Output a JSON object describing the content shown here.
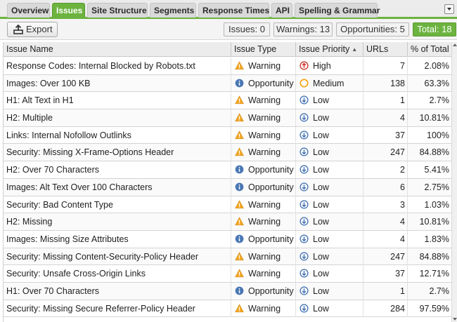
{
  "tabs": [
    {
      "label": "Overview",
      "active": false
    },
    {
      "label": "Issues",
      "active": true
    },
    {
      "label": "Site Structure",
      "active": false
    },
    {
      "label": "Segments",
      "active": false
    },
    {
      "label": "Response Times",
      "active": false
    },
    {
      "label": "API",
      "active": false
    },
    {
      "label": "Spelling & Grammar",
      "active": false
    }
  ],
  "toolbar": {
    "export_label": "Export",
    "issues": "Issues: 0",
    "warnings": "Warnings: 13",
    "opportunities": "Opportunities: 5",
    "total": "Total: 18"
  },
  "columns": {
    "name": "Issue Name",
    "type": "Issue Type",
    "priority": "Issue Priority",
    "urls": "URLs",
    "pct": "% of Total"
  },
  "colors": {
    "accent": "#6cb33f",
    "warning": "#f5a623",
    "opportunity": "#4a77b4",
    "high": "#d0342c",
    "medium": "#f2a20c",
    "low": "#4a77b4"
  },
  "rows": [
    {
      "name": "Response Codes: Internal Blocked by Robots.txt",
      "type": "Warning",
      "type_icon": "warning-icon",
      "priority": "High",
      "priority_icon": "arrow-up-circle-icon",
      "urls": "7",
      "pct": "2.08%"
    },
    {
      "name": "Images: Over 100 KB",
      "type": "Opportunity",
      "type_icon": "info-icon",
      "priority": "Medium",
      "priority_icon": "circle-icon",
      "urls": "138",
      "pct": "63.3%"
    },
    {
      "name": "H1: Alt Text in H1",
      "type": "Warning",
      "type_icon": "warning-icon",
      "priority": "Low",
      "priority_icon": "arrow-down-circle-icon",
      "urls": "1",
      "pct": "2.7%"
    },
    {
      "name": "H2: Multiple",
      "type": "Warning",
      "type_icon": "warning-icon",
      "priority": "Low",
      "priority_icon": "arrow-down-circle-icon",
      "urls": "4",
      "pct": "10.81%"
    },
    {
      "name": "Links: Internal Nofollow Outlinks",
      "type": "Warning",
      "type_icon": "warning-icon",
      "priority": "Low",
      "priority_icon": "arrow-down-circle-icon",
      "urls": "37",
      "pct": "100%"
    },
    {
      "name": "Security: Missing X-Frame-Options Header",
      "type": "Warning",
      "type_icon": "warning-icon",
      "priority": "Low",
      "priority_icon": "arrow-down-circle-icon",
      "urls": "247",
      "pct": "84.88%"
    },
    {
      "name": "H2: Over 70 Characters",
      "type": "Opportunity",
      "type_icon": "info-icon",
      "priority": "Low",
      "priority_icon": "arrow-down-circle-icon",
      "urls": "2",
      "pct": "5.41%"
    },
    {
      "name": "Images: Alt Text Over 100 Characters",
      "type": "Opportunity",
      "type_icon": "info-icon",
      "priority": "Low",
      "priority_icon": "arrow-down-circle-icon",
      "urls": "6",
      "pct": "2.75%"
    },
    {
      "name": "Security: Bad Content Type",
      "type": "Warning",
      "type_icon": "warning-icon",
      "priority": "Low",
      "priority_icon": "arrow-down-circle-icon",
      "urls": "3",
      "pct": "1.03%"
    },
    {
      "name": "H2: Missing",
      "type": "Warning",
      "type_icon": "warning-icon",
      "priority": "Low",
      "priority_icon": "arrow-down-circle-icon",
      "urls": "4",
      "pct": "10.81%"
    },
    {
      "name": "Images: Missing Size Attributes",
      "type": "Opportunity",
      "type_icon": "info-icon",
      "priority": "Low",
      "priority_icon": "arrow-down-circle-icon",
      "urls": "4",
      "pct": "1.83%"
    },
    {
      "name": "Security: Missing Content-Security-Policy Header",
      "type": "Warning",
      "type_icon": "warning-icon",
      "priority": "Low",
      "priority_icon": "arrow-down-circle-icon",
      "urls": "247",
      "pct": "84.88%"
    },
    {
      "name": "Security: Unsafe Cross-Origin Links",
      "type": "Warning",
      "type_icon": "warning-icon",
      "priority": "Low",
      "priority_icon": "arrow-down-circle-icon",
      "urls": "37",
      "pct": "12.71%"
    },
    {
      "name": "H1: Over 70 Characters",
      "type": "Opportunity",
      "type_icon": "info-icon",
      "priority": "Low",
      "priority_icon": "arrow-down-circle-icon",
      "urls": "1",
      "pct": "2.7%"
    },
    {
      "name": "Security: Missing Secure Referrer-Policy Header",
      "type": "Warning",
      "type_icon": "warning-icon",
      "priority": "Low",
      "priority_icon": "arrow-down-circle-icon",
      "urls": "284",
      "pct": "97.59%"
    }
  ]
}
